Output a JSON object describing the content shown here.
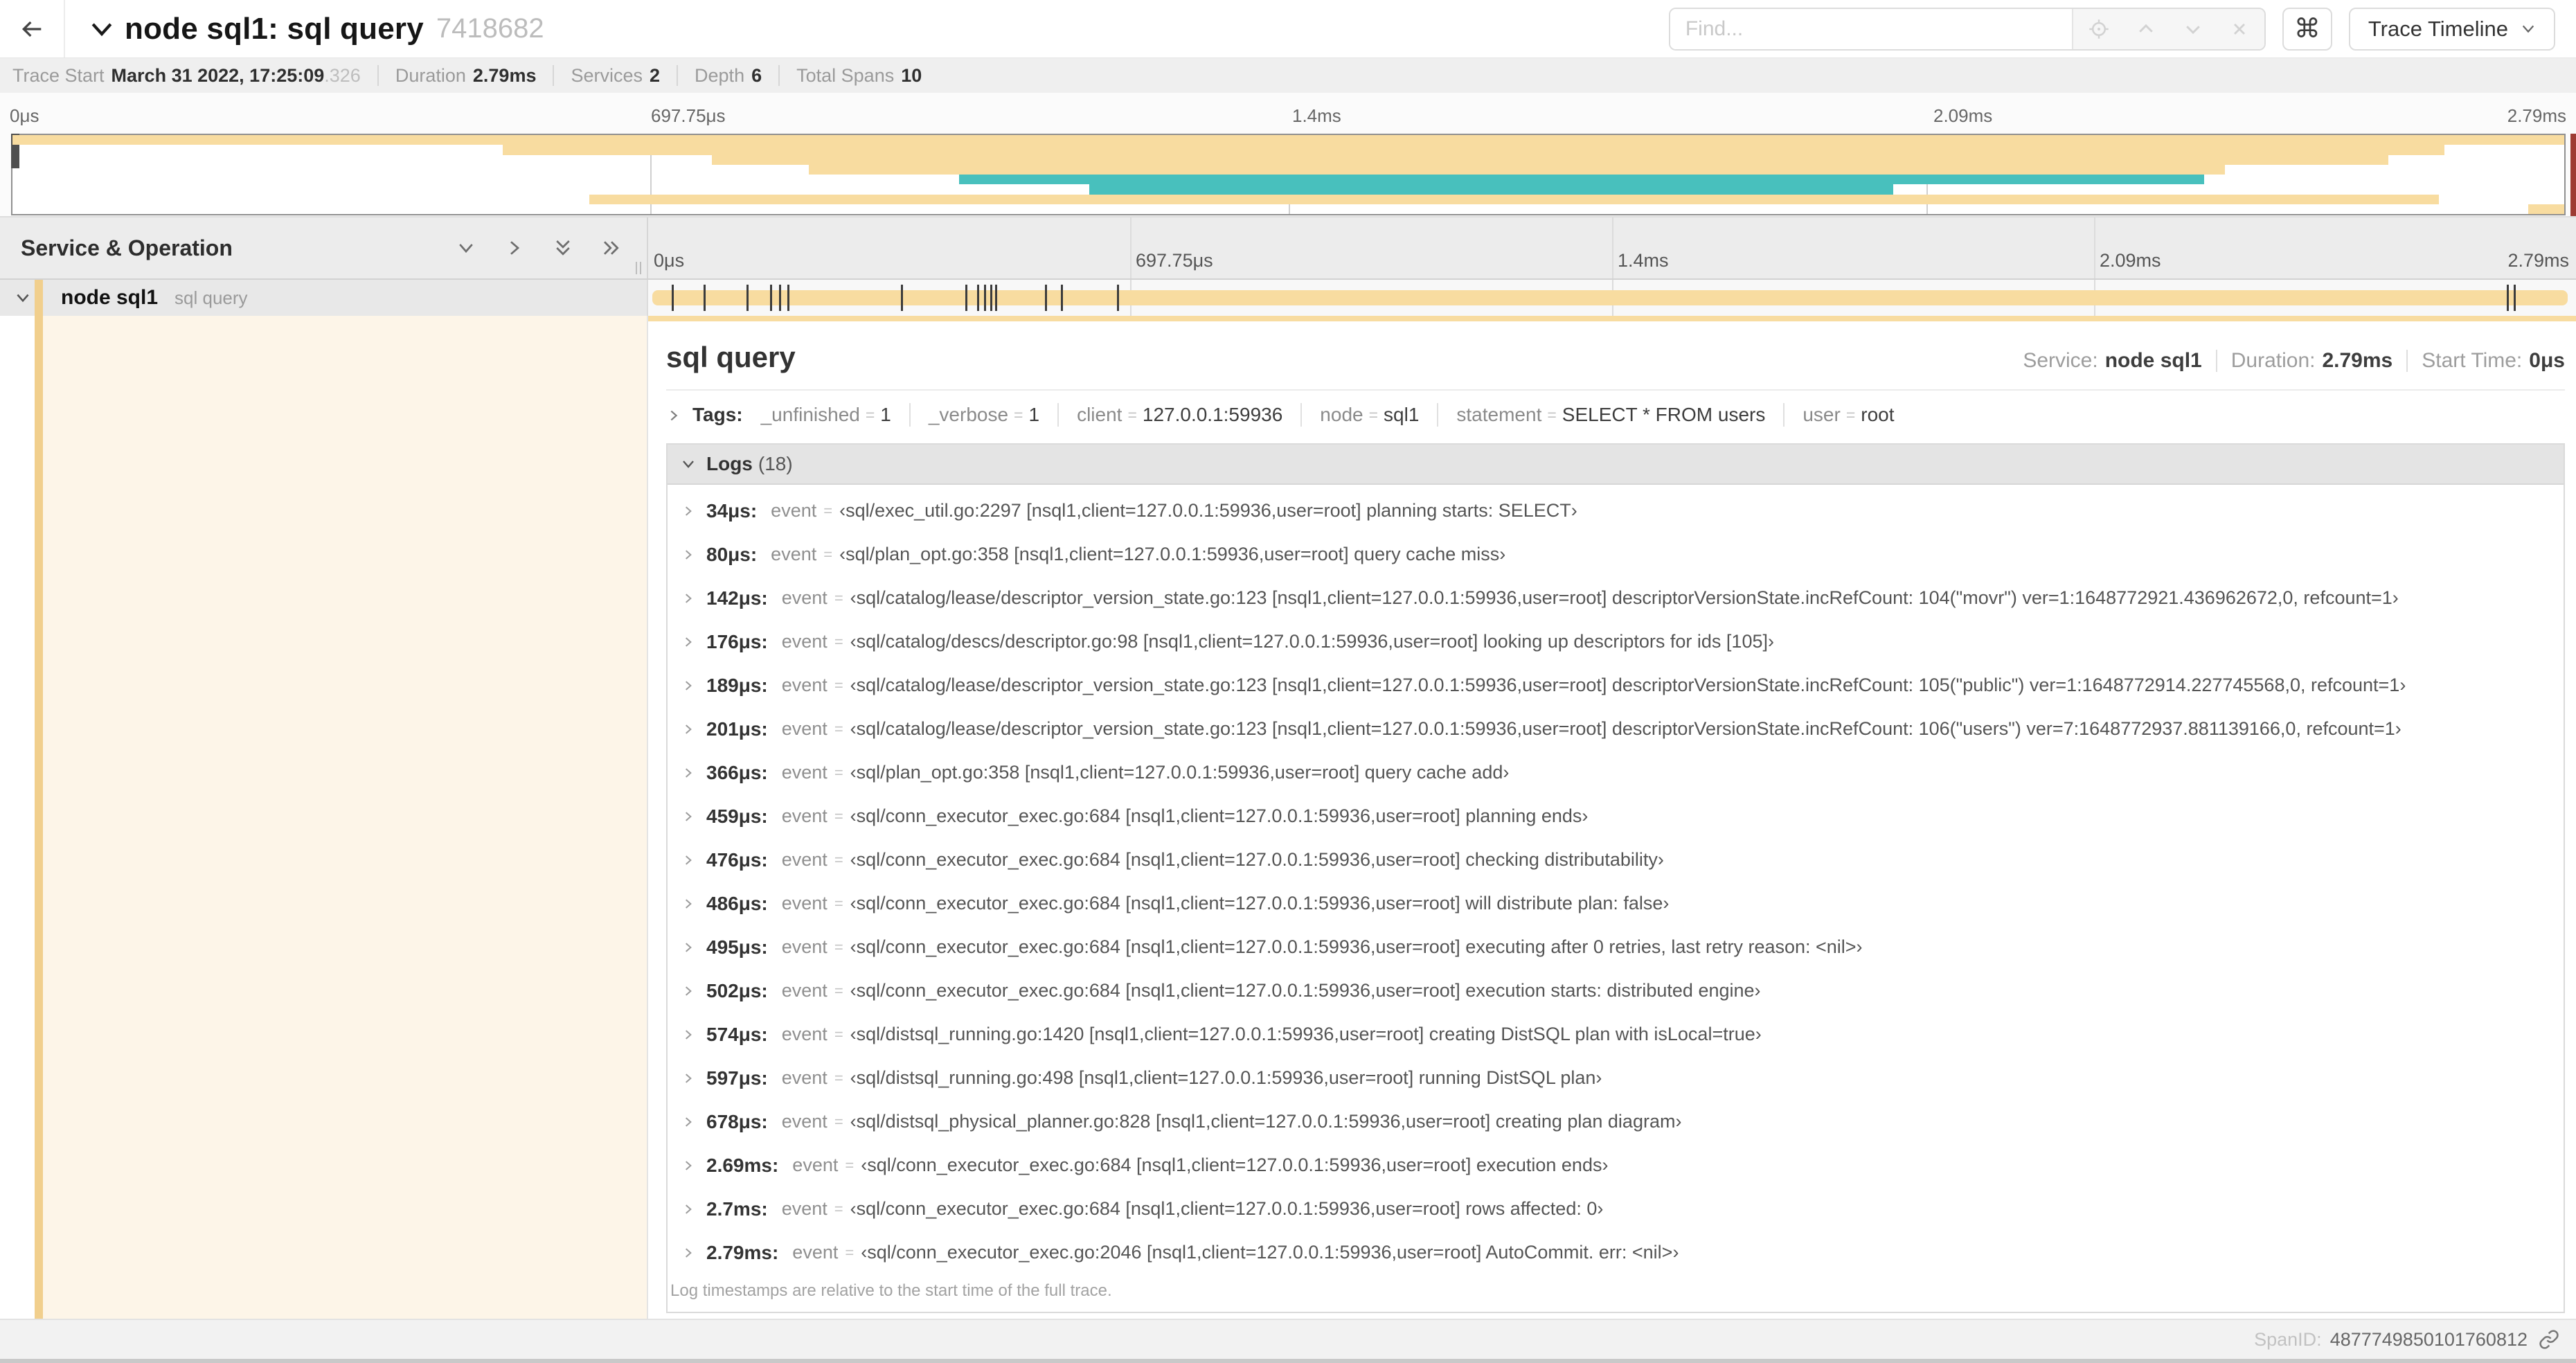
{
  "colors": {
    "tan": "#f8dca0",
    "teal": "#48c0bd",
    "cream": "#fdf5e8",
    "stripe": "#f1cf8d"
  },
  "header": {
    "title": "node sql1: sql query",
    "trace_id": "7418682",
    "find_placeholder": "Find...",
    "cmd_symbol": "⌘",
    "view_button": "Trace Timeline"
  },
  "stats": {
    "items": [
      {
        "label": "Trace Start",
        "value": "March 31 2022, 17:25:09",
        "suffix": ".326"
      },
      {
        "label": "Duration",
        "value": "2.79ms",
        "suffix": ""
      },
      {
        "label": "Services",
        "value": "2",
        "suffix": ""
      },
      {
        "label": "Depth",
        "value": "6",
        "suffix": ""
      },
      {
        "label": "Total Spans",
        "value": "10",
        "suffix": ""
      }
    ]
  },
  "minimap": {
    "ticks": [
      "0μs",
      "697.75μs",
      "1.4ms",
      "2.09ms",
      "2.79ms"
    ],
    "spans": [
      {
        "row": 0,
        "start": 0.0,
        "end": 1.0,
        "color": "tan"
      },
      {
        "row": 1,
        "start": 0.192,
        "end": 0.953,
        "color": "tan"
      },
      {
        "row": 2,
        "start": 0.274,
        "end": 0.931,
        "color": "tan"
      },
      {
        "row": 3,
        "start": 0.312,
        "end": 0.867,
        "color": "tan"
      },
      {
        "row": 4,
        "start": 0.371,
        "end": 0.859,
        "color": "teal"
      },
      {
        "row": 5,
        "start": 0.422,
        "end": 0.737,
        "color": "teal"
      },
      {
        "row": 6,
        "start": 0.226,
        "end": 0.951,
        "color": "tan"
      },
      {
        "row": 7,
        "start": 0.986,
        "end": 1.0,
        "color": "tan"
      }
    ]
  },
  "timeline": {
    "header": "Service & Operation",
    "ticks": [
      "0μs",
      "697.75μs",
      "1.4ms",
      "2.09ms",
      "2.79ms"
    ]
  },
  "span_row": {
    "service": "node sql1",
    "operation": "sql query",
    "total_us": 2790,
    "log_ticks_us": [
      34,
      80,
      142,
      176,
      189,
      201,
      366,
      459,
      476,
      486,
      495,
      502,
      574,
      597,
      678,
      2690,
      2700
    ]
  },
  "detail": {
    "title": "sql query",
    "overview": {
      "service_label": "Service:",
      "service": "node sql1",
      "duration_label": "Duration:",
      "duration": "2.79ms",
      "start_label": "Start Time:",
      "start": "0μs"
    },
    "tags_label": "Tags:",
    "tags": [
      {
        "key": "_unfinished",
        "value": "1"
      },
      {
        "key": "_verbose",
        "value": "1"
      },
      {
        "key": "client",
        "value": "127.0.0.1:59936"
      },
      {
        "key": "node",
        "value": "sql1"
      },
      {
        "key": "statement",
        "value": "SELECT * FROM users"
      },
      {
        "key": "user",
        "value": "root"
      }
    ],
    "logs_label": "Logs",
    "logs_count": "(18)",
    "log_field": "event",
    "logs": [
      {
        "time": "34μs:",
        "value": "‹sql/exec_util.go:2297 [nsql1,client=127.0.0.1:59936,user=root] planning starts: SELECT›"
      },
      {
        "time": "80μs:",
        "value": "‹sql/plan_opt.go:358 [nsql1,client=127.0.0.1:59936,user=root] query cache miss›"
      },
      {
        "time": "142μs:",
        "value": "‹sql/catalog/lease/descriptor_version_state.go:123 [nsql1,client=127.0.0.1:59936,user=root] descriptorVersionState.incRefCount: 104(\"movr\") ver=1:1648772921.436962672,0, refcount=1›"
      },
      {
        "time": "176μs:",
        "value": "‹sql/catalog/descs/descriptor.go:98 [nsql1,client=127.0.0.1:59936,user=root] looking up descriptors for ids [105]›"
      },
      {
        "time": "189μs:",
        "value": "‹sql/catalog/lease/descriptor_version_state.go:123 [nsql1,client=127.0.0.1:59936,user=root] descriptorVersionState.incRefCount: 105(\"public\") ver=1:1648772914.227745568,0, refcount=1›"
      },
      {
        "time": "201μs:",
        "value": "‹sql/catalog/lease/descriptor_version_state.go:123 [nsql1,client=127.0.0.1:59936,user=root] descriptorVersionState.incRefCount: 106(\"users\") ver=7:1648772937.881139166,0, refcount=1›"
      },
      {
        "time": "366μs:",
        "value": "‹sql/plan_opt.go:358 [nsql1,client=127.0.0.1:59936,user=root] query cache add›"
      },
      {
        "time": "459μs:",
        "value": "‹sql/conn_executor_exec.go:684 [nsql1,client=127.0.0.1:59936,user=root] planning ends›"
      },
      {
        "time": "476μs:",
        "value": "‹sql/conn_executor_exec.go:684 [nsql1,client=127.0.0.1:59936,user=root] checking distributability›"
      },
      {
        "time": "486μs:",
        "value": "‹sql/conn_executor_exec.go:684 [nsql1,client=127.0.0.1:59936,user=root] will distribute plan: false›"
      },
      {
        "time": "495μs:",
        "value": "‹sql/conn_executor_exec.go:684 [nsql1,client=127.0.0.1:59936,user=root] executing after 0 retries, last retry reason: <nil>›"
      },
      {
        "time": "502μs:",
        "value": "‹sql/conn_executor_exec.go:684 [nsql1,client=127.0.0.1:59936,user=root] execution starts: distributed engine›"
      },
      {
        "time": "574μs:",
        "value": "‹sql/distsql_running.go:1420 [nsql1,client=127.0.0.1:59936,user=root] creating DistSQL plan with isLocal=true›"
      },
      {
        "time": "597μs:",
        "value": "‹sql/distsql_running.go:498 [nsql1,client=127.0.0.1:59936,user=root] running DistSQL plan›"
      },
      {
        "time": "678μs:",
        "value": "‹sql/distsql_physical_planner.go:828 [nsql1,client=127.0.0.1:59936,user=root] creating plan diagram›"
      },
      {
        "time": "2.69ms:",
        "value": "‹sql/conn_executor_exec.go:684 [nsql1,client=127.0.0.1:59936,user=root] execution ends›"
      },
      {
        "time": "2.7ms:",
        "value": "‹sql/conn_executor_exec.go:684 [nsql1,client=127.0.0.1:59936,user=root] rows affected: 0›"
      },
      {
        "time": "2.79ms:",
        "value": "‹sql/conn_executor_exec.go:2046 [nsql1,client=127.0.0.1:59936,user=root] AutoCommit. err: <nil>›"
      }
    ],
    "note": "Log timestamps are relative to the start time of the full trace.",
    "spanid_label": "SpanID:",
    "spanid": "4877749850101760812"
  }
}
